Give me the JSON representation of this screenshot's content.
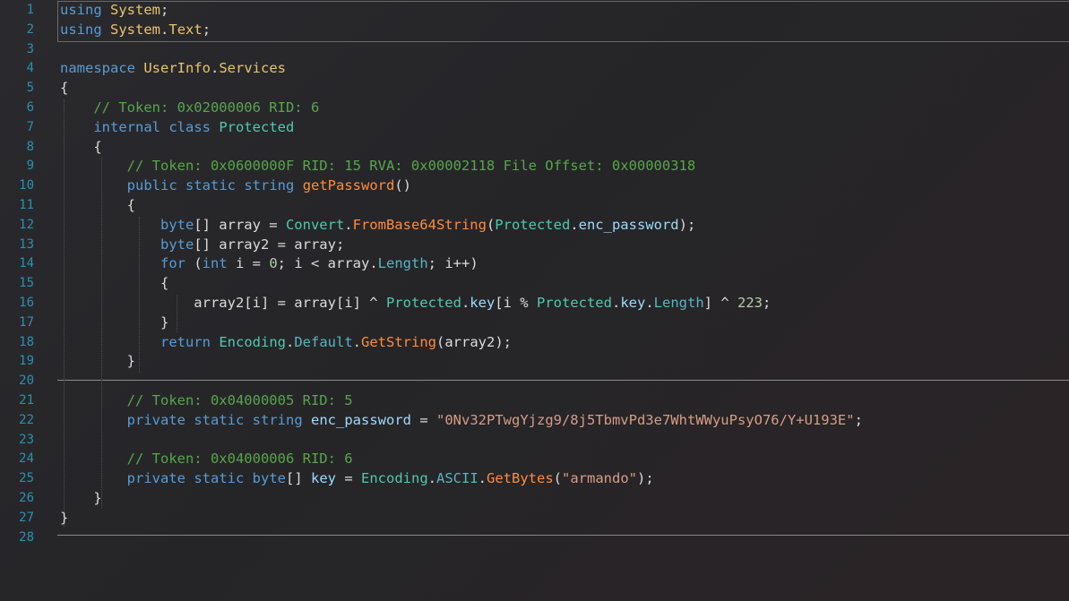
{
  "editor": {
    "lines": [
      {
        "n": "1",
        "segs": [
          [
            "kw",
            "using"
          ],
          [
            "pl",
            " "
          ],
          [
            "nsn",
            "System"
          ],
          [
            "pl",
            ";"
          ]
        ]
      },
      {
        "n": "2",
        "segs": [
          [
            "kw",
            "using"
          ],
          [
            "pl",
            " "
          ],
          [
            "nsn",
            "System"
          ],
          [
            "pl",
            "."
          ],
          [
            "nsn",
            "Text"
          ],
          [
            "pl",
            ";"
          ]
        ]
      },
      {
        "n": "3",
        "segs": []
      },
      {
        "n": "4",
        "segs": [
          [
            "kw",
            "namespace"
          ],
          [
            "pl",
            " "
          ],
          [
            "nsn",
            "UserInfo"
          ],
          [
            "pl",
            "."
          ],
          [
            "nsn",
            "Services"
          ]
        ]
      },
      {
        "n": "5",
        "segs": [
          [
            "pl",
            "{"
          ]
        ]
      },
      {
        "n": "6",
        "segs": [
          [
            "pl",
            "    "
          ],
          [
            "cm",
            "// Token: 0x02000006 RID: 6"
          ]
        ]
      },
      {
        "n": "7",
        "segs": [
          [
            "pl",
            "    "
          ],
          [
            "kw",
            "internal"
          ],
          [
            "pl",
            " "
          ],
          [
            "kw",
            "class"
          ],
          [
            "pl",
            " "
          ],
          [
            "ty",
            "Protected"
          ]
        ]
      },
      {
        "n": "8",
        "segs": [
          [
            "pl",
            "    {"
          ]
        ]
      },
      {
        "n": "9",
        "segs": [
          [
            "pl",
            "        "
          ],
          [
            "cm",
            "// Token: 0x0600000F RID: 15 RVA: 0x00002118 File Offset: 0x00000318"
          ]
        ]
      },
      {
        "n": "10",
        "segs": [
          [
            "pl",
            "        "
          ],
          [
            "kw",
            "public"
          ],
          [
            "pl",
            " "
          ],
          [
            "kw",
            "static"
          ],
          [
            "pl",
            " "
          ],
          [
            "kw",
            "string"
          ],
          [
            "pl",
            " "
          ],
          [
            "me",
            "getPassword"
          ],
          [
            "pl",
            "()"
          ]
        ]
      },
      {
        "n": "11",
        "segs": [
          [
            "pl",
            "        {"
          ]
        ]
      },
      {
        "n": "12",
        "segs": [
          [
            "pl",
            "            "
          ],
          [
            "kw",
            "byte"
          ],
          [
            "pl",
            "[] array = "
          ],
          [
            "ty",
            "Convert"
          ],
          [
            "pl",
            "."
          ],
          [
            "me",
            "FromBase64String"
          ],
          [
            "pl",
            "("
          ],
          [
            "ty",
            "Protected"
          ],
          [
            "pl",
            "."
          ],
          [
            "fd",
            "enc_password"
          ],
          [
            "pl",
            ");"
          ]
        ]
      },
      {
        "n": "13",
        "segs": [
          [
            "pl",
            "            "
          ],
          [
            "kw",
            "byte"
          ],
          [
            "pl",
            "[] array2 = array;"
          ]
        ]
      },
      {
        "n": "14",
        "segs": [
          [
            "pl",
            "            "
          ],
          [
            "kw",
            "for"
          ],
          [
            "pl",
            " ("
          ],
          [
            "kw",
            "int"
          ],
          [
            "pl",
            " i = "
          ],
          [
            "nm",
            "0"
          ],
          [
            "pl",
            "; i < array."
          ],
          [
            "mb",
            "Length"
          ],
          [
            "pl",
            "; i++)"
          ]
        ]
      },
      {
        "n": "15",
        "segs": [
          [
            "pl",
            "            {"
          ]
        ]
      },
      {
        "n": "16",
        "segs": [
          [
            "pl",
            "                array2[i] = array[i] ^ "
          ],
          [
            "ty",
            "Protected"
          ],
          [
            "pl",
            "."
          ],
          [
            "fd",
            "key"
          ],
          [
            "pl",
            "[i % "
          ],
          [
            "ty",
            "Protected"
          ],
          [
            "pl",
            "."
          ],
          [
            "fd",
            "key"
          ],
          [
            "pl",
            "."
          ],
          [
            "mb",
            "Length"
          ],
          [
            "pl",
            "] ^ "
          ],
          [
            "nm",
            "223"
          ],
          [
            "pl",
            ";"
          ]
        ]
      },
      {
        "n": "17",
        "segs": [
          [
            "pl",
            "            }"
          ]
        ]
      },
      {
        "n": "18",
        "segs": [
          [
            "pl",
            "            "
          ],
          [
            "kw",
            "return"
          ],
          [
            "pl",
            " "
          ],
          [
            "ty",
            "Encoding"
          ],
          [
            "pl",
            "."
          ],
          [
            "mb",
            "Default"
          ],
          [
            "pl",
            "."
          ],
          [
            "me",
            "GetString"
          ],
          [
            "pl",
            "(array2);"
          ]
        ]
      },
      {
        "n": "19",
        "segs": [
          [
            "pl",
            "        }"
          ]
        ]
      },
      {
        "n": "20",
        "segs": []
      },
      {
        "n": "21",
        "segs": [
          [
            "pl",
            "        "
          ],
          [
            "cm",
            "// Token: 0x04000005 RID: 5"
          ]
        ]
      },
      {
        "n": "22",
        "segs": [
          [
            "pl",
            "        "
          ],
          [
            "kw",
            "private"
          ],
          [
            "pl",
            " "
          ],
          [
            "kw",
            "static"
          ],
          [
            "pl",
            " "
          ],
          [
            "kw",
            "string"
          ],
          [
            "pl",
            " "
          ],
          [
            "fd",
            "enc_password"
          ],
          [
            "pl",
            " = "
          ],
          [
            "st",
            "\"0Nv32PTwgYjzg9/8j5TbmvPd3e7WhtWWyuPsyO76/Y+U193E\""
          ],
          [
            "pl",
            ";"
          ]
        ]
      },
      {
        "n": "23",
        "segs": []
      },
      {
        "n": "24",
        "segs": [
          [
            "pl",
            "        "
          ],
          [
            "cm",
            "// Token: 0x04000006 RID: 6"
          ]
        ]
      },
      {
        "n": "25",
        "segs": [
          [
            "pl",
            "        "
          ],
          [
            "kw",
            "private"
          ],
          [
            "pl",
            " "
          ],
          [
            "kw",
            "static"
          ],
          [
            "pl",
            " "
          ],
          [
            "kw",
            "byte"
          ],
          [
            "pl",
            "[] "
          ],
          [
            "fd",
            "key"
          ],
          [
            "pl",
            " = "
          ],
          [
            "ty",
            "Encoding"
          ],
          [
            "pl",
            "."
          ],
          [
            "mb",
            "ASCII"
          ],
          [
            "pl",
            "."
          ],
          [
            "me",
            "GetBytes"
          ],
          [
            "pl",
            "("
          ],
          [
            "st",
            "\"armando\""
          ],
          [
            "pl",
            ");"
          ]
        ]
      },
      {
        "n": "26",
        "segs": [
          [
            "pl",
            "    }"
          ]
        ]
      },
      {
        "n": "27",
        "segs": [
          [
            "pl",
            "}"
          ]
        ]
      },
      {
        "n": "28",
        "segs": []
      }
    ]
  }
}
